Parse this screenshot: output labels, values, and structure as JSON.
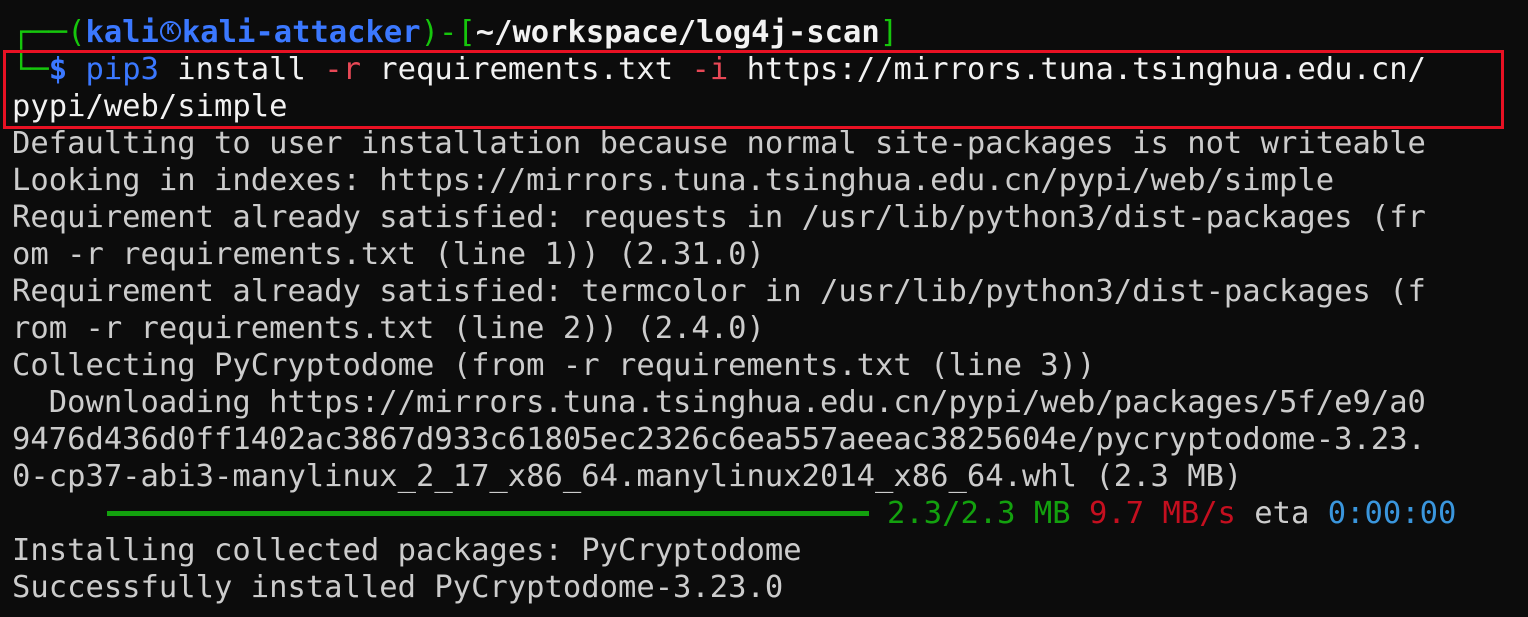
{
  "prompt": {
    "corner_top": "┌──(",
    "user": "kali",
    "logo_glyph": "K",
    "host": "kali-attacker",
    "sep": ")-[",
    "cwd": "~/workspace/log4j-scan",
    "close_bracket": "]",
    "corner_bottom": "└─",
    "dollar": "$"
  },
  "command": {
    "binary": "pip3",
    "arg1": " install ",
    "flag_r": "-r",
    "arg2": " requirements.txt ",
    "flag_i": "-i",
    "url_part1": " https://mirrors.tuna.tsinghua.edu.cn/",
    "url_part2": "pypi/web/simple"
  },
  "output_lines": [
    "Defaulting to user installation because normal site-packages is not writeable",
    "Looking in indexes: https://mirrors.tuna.tsinghua.edu.cn/pypi/web/simple",
    "Requirement already satisfied: requests in /usr/lib/python3/dist-packages (fr",
    "om -r requirements.txt (line 1)) (2.31.0)",
    "Requirement already satisfied: termcolor in /usr/lib/python3/dist-packages (f",
    "rom -r requirements.txt (line 2)) (2.4.0)",
    "Collecting PyCryptodome (from -r requirements.txt (line 3))",
    "  Downloading https://mirrors.tuna.tsinghua.edu.cn/pypi/web/packages/5f/e9/a0",
    "9476d436d0ff1402ac3867d933c61805ec2326c6ea557aeeac3825604e/pycryptodome-3.23.",
    "0-cp37-abi3-manylinux_2_17_x86_64.manylinux2014_x86_64.whl (2.3 MB)"
  ],
  "progress": {
    "fraction": 1.0,
    "size": "2.3/2.3 MB",
    "speed": "9.7 MB/s",
    "eta_label": "eta",
    "eta": "0:00:00"
  },
  "final_lines": [
    "Installing collected packages: PyCryptodome",
    "Successfully installed PyCryptodome-3.23.0"
  ],
  "colors": {
    "background": "#0c0c0c",
    "prompt_green": "#16c60c",
    "prompt_blue": "#3b78ff",
    "flag_red": "#e74856",
    "highlight_border": "#e81123",
    "progress_green": "#13a10e",
    "speed_red": "#c50f1f",
    "eta_blue": "#3a96dd"
  }
}
